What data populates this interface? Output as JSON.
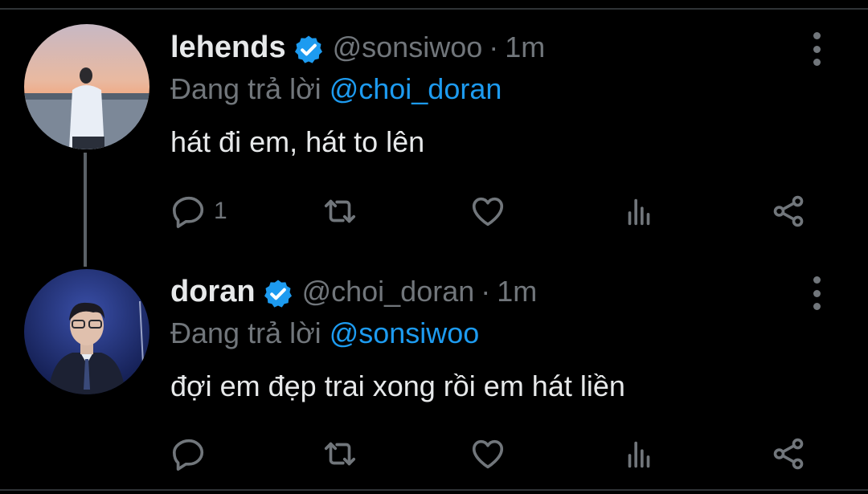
{
  "colors": {
    "background": "#000000",
    "text": "#e7e9ea",
    "muted": "#71767b",
    "mention": "#1d9bf0",
    "verified": "#1d9bf0"
  },
  "tweets": [
    {
      "display_name": "lehends",
      "handle": "@sonsiwoo",
      "separator": "·",
      "time": "1m",
      "reply_prefix": "Đang trả lời",
      "reply_to": "@choi_doran",
      "text": "hát đi em, hát to lên",
      "reply_count": "1",
      "icons": [
        "reply-icon",
        "retweet-icon",
        "like-icon",
        "analytics-icon",
        "share-icon",
        "more-icon",
        "verified-icon"
      ]
    },
    {
      "display_name": "doran",
      "handle": "@choi_doran",
      "separator": "·",
      "time": "1m",
      "reply_prefix": "Đang trả lời",
      "reply_to": "@sonsiwoo",
      "text": "đợi em đẹp trai xong rồi em hát liền",
      "reply_count": "",
      "icons": [
        "reply-icon",
        "retweet-icon",
        "like-icon",
        "analytics-icon",
        "share-icon",
        "more-icon",
        "verified-icon"
      ]
    }
  ]
}
